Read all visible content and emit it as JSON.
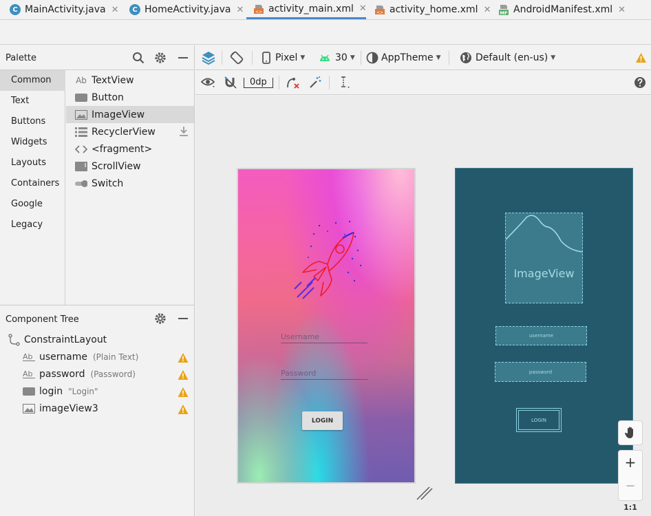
{
  "tabs": [
    {
      "label": "MainActivity.java",
      "icon": "java-class-icon",
      "active": false
    },
    {
      "label": "HomeActivity.java",
      "icon": "java-class-icon",
      "active": false
    },
    {
      "label": "activity_main.xml",
      "icon": "layout-xml-icon",
      "active": true
    },
    {
      "label": "activity_home.xml",
      "icon": "layout-xml-icon",
      "active": false
    },
    {
      "label": "AndroidManifest.xml",
      "icon": "manifest-icon",
      "active": false
    }
  ],
  "palette": {
    "title": "Palette",
    "categories": [
      "Common",
      "Text",
      "Buttons",
      "Widgets",
      "Layouts",
      "Containers",
      "Google",
      "Legacy"
    ],
    "selected_category": "Common",
    "widgets": [
      {
        "label": "TextView",
        "icon": "textview-icon"
      },
      {
        "label": "Button",
        "icon": "button-icon"
      },
      {
        "label": "ImageView",
        "icon": "imageview-icon"
      },
      {
        "label": "RecyclerView",
        "icon": "recyclerview-icon"
      },
      {
        "label": "<fragment>",
        "icon": "fragment-icon"
      },
      {
        "label": "ScrollView",
        "icon": "scrollview-icon"
      },
      {
        "label": "Switch",
        "icon": "switch-icon"
      }
    ],
    "selected_widget": "ImageView",
    "icon_text": "Ab",
    "manifest_icon_text": "MF",
    "java_icon_text": "C"
  },
  "toolbar": {
    "device": "Pixel",
    "api": "30",
    "theme": "AppTheme",
    "locale": "Default (en-us)",
    "margin": "0dp"
  },
  "tree": {
    "title": "Component Tree",
    "root": "ConstraintLayout",
    "nodes": [
      {
        "name": "username",
        "hint": "(Plain Text)",
        "icon": "textview-icon"
      },
      {
        "name": "password",
        "hint": "(Password)",
        "icon": "textview-icon"
      },
      {
        "name": "login",
        "hint": "\"Login\"",
        "icon": "button-icon"
      },
      {
        "name": "imageView3",
        "hint": "",
        "icon": "imageview-icon"
      }
    ]
  },
  "design": {
    "username_hint": "Username",
    "password_hint": "Password",
    "login_label": "LOGIN"
  },
  "blueprint": {
    "imageview_label": "ImageView",
    "username_label": "username",
    "password_label": "password",
    "login_label": "LOGIN"
  },
  "zoom": {
    "plus": "+",
    "minus": "−",
    "fit": "1:1"
  },
  "colors": {
    "accent": "#4a88c7",
    "warning": "#e8a417",
    "blueprint_bg": "#24596c"
  }
}
